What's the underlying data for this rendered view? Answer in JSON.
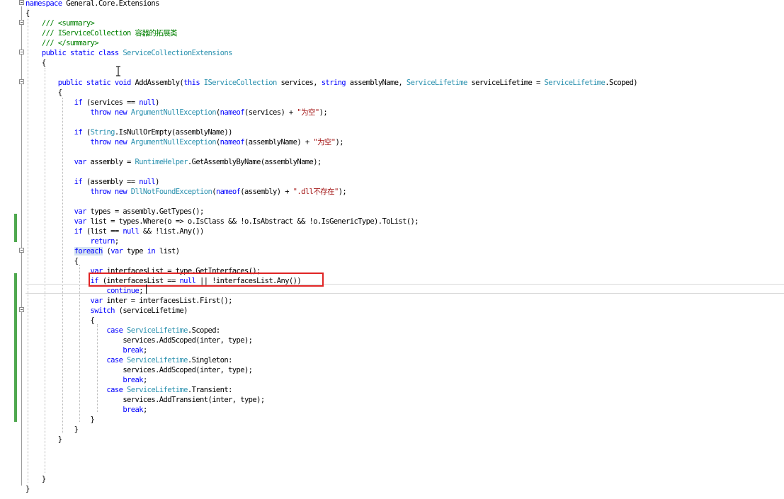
{
  "editor": {
    "lines": [
      [
        [
          "namespace",
          "kw"
        ],
        [
          " General.Core.Extensions",
          ""
        ]
      ],
      [
        [
          "{",
          ""
        ]
      ],
      [
        [
          "    /// <summary>",
          "cm"
        ]
      ],
      [
        [
          "    /// IServiceCollection 容器的拓展类",
          "cm"
        ]
      ],
      [
        [
          "    /// </summary>",
          "cm"
        ]
      ],
      [
        [
          "    public static class ",
          "kw"
        ],
        [
          "ServiceCollectionExtensions",
          "ty"
        ]
      ],
      [
        [
          "    {",
          ""
        ]
      ],
      [
        [
          "",
          ""
        ]
      ],
      [
        [
          "        public static void ",
          "kw"
        ],
        [
          "AddAssembly(",
          ""
        ],
        [
          "this ",
          "kw"
        ],
        [
          "IServiceCollection",
          "ty"
        ],
        [
          " services, ",
          ""
        ],
        [
          "string ",
          "kw"
        ],
        [
          "assemblyName, ",
          ""
        ],
        [
          "ServiceLifetime",
          "ty"
        ],
        [
          " serviceLifetime = ",
          ""
        ],
        [
          "ServiceLifetime",
          "ty"
        ],
        [
          ".Scoped)",
          ""
        ]
      ],
      [
        [
          "        {",
          ""
        ]
      ],
      [
        [
          "            if ",
          "kw"
        ],
        [
          "(services == ",
          ""
        ],
        [
          "null",
          "kw"
        ],
        [
          ")",
          ""
        ]
      ],
      [
        [
          "                throw new ",
          "kw"
        ],
        [
          "ArgumentNullException",
          "ty"
        ],
        [
          "(",
          ""
        ],
        [
          "nameof",
          "kw"
        ],
        [
          "(services) + ",
          ""
        ],
        [
          "\"为空\"",
          "st"
        ],
        [
          ");",
          ""
        ]
      ],
      [
        [
          "",
          ""
        ]
      ],
      [
        [
          "            if ",
          "kw"
        ],
        [
          "(",
          ""
        ],
        [
          "String",
          "ty"
        ],
        [
          ".IsNullOrEmpty(assemblyName))",
          ""
        ]
      ],
      [
        [
          "                throw new ",
          "kw"
        ],
        [
          "ArgumentNullException",
          "ty"
        ],
        [
          "(",
          ""
        ],
        [
          "nameof",
          "kw"
        ],
        [
          "(assemblyName) + ",
          ""
        ],
        [
          "\"为空\"",
          "st"
        ],
        [
          ");",
          ""
        ]
      ],
      [
        [
          "",
          ""
        ]
      ],
      [
        [
          "            var ",
          "kw"
        ],
        [
          "assembly = ",
          ""
        ],
        [
          "RuntimeHelper",
          "ty"
        ],
        [
          ".GetAssemblyByName(assemblyName);",
          ""
        ]
      ],
      [
        [
          "",
          ""
        ]
      ],
      [
        [
          "            if ",
          "kw"
        ],
        [
          "(assembly == ",
          ""
        ],
        [
          "null",
          "kw"
        ],
        [
          ")",
          ""
        ]
      ],
      [
        [
          "                throw new ",
          "kw"
        ],
        [
          "DllNotFoundException",
          "ty"
        ],
        [
          "(",
          ""
        ],
        [
          "nameof",
          "kw"
        ],
        [
          "(assembly) + ",
          ""
        ],
        [
          "\".dll不存在\"",
          "st"
        ],
        [
          ");",
          ""
        ]
      ],
      [
        [
          "",
          ""
        ]
      ],
      [
        [
          "            var ",
          "kw"
        ],
        [
          "types = assembly.GetTypes();",
          ""
        ]
      ],
      [
        [
          "            var ",
          "kw"
        ],
        [
          "list = types.Where(o => o.IsClass && !o.IsAbstract && !o.IsGenericType).ToList();",
          ""
        ]
      ],
      [
        [
          "            if ",
          "kw"
        ],
        [
          "(list == ",
          ""
        ],
        [
          "null ",
          "kw"
        ],
        [
          "&& !list.Any())",
          ""
        ]
      ],
      [
        [
          "                return",
          "kw"
        ],
        [
          ";",
          ""
        ]
      ],
      [
        [
          "            ",
          ""
        ],
        [
          "foreach",
          "kw hl"
        ],
        [
          " (",
          ""
        ],
        [
          "var ",
          "kw"
        ],
        [
          "type ",
          ""
        ],
        [
          "in ",
          "kw"
        ],
        [
          "list)",
          ""
        ]
      ],
      [
        [
          "            {",
          ""
        ]
      ],
      [
        [
          "                var ",
          "kw"
        ],
        [
          "interfacesList = type.GetInterfaces();",
          ""
        ]
      ],
      [
        [
          "                if ",
          "kw"
        ],
        [
          "(interfacesList == ",
          ""
        ],
        [
          "null ",
          "kw"
        ],
        [
          "|| !interfacesList.Any())",
          ""
        ]
      ],
      [
        [
          "                    continue",
          "kw"
        ],
        [
          ";",
          ""
        ]
      ],
      [
        [
          "                var ",
          "kw"
        ],
        [
          "inter = interfacesList.First();",
          ""
        ]
      ],
      [
        [
          "                switch ",
          "kw"
        ],
        [
          "(serviceLifetime)",
          ""
        ]
      ],
      [
        [
          "                {",
          ""
        ]
      ],
      [
        [
          "                    case ",
          "kw"
        ],
        [
          "ServiceLifetime",
          "ty"
        ],
        [
          ".Scoped:",
          ""
        ]
      ],
      [
        [
          "                        services.AddScoped(inter, type);",
          ""
        ]
      ],
      [
        [
          "                        break",
          "kw"
        ],
        [
          ";",
          ""
        ]
      ],
      [
        [
          "                    case ",
          "kw"
        ],
        [
          "ServiceLifetime",
          "ty"
        ],
        [
          ".Singleton:",
          ""
        ]
      ],
      [
        [
          "                        services.AddScoped(inter, type);",
          ""
        ]
      ],
      [
        [
          "                        break",
          "kw"
        ],
        [
          ";",
          ""
        ]
      ],
      [
        [
          "                    case ",
          "kw"
        ],
        [
          "ServiceLifetime",
          "ty"
        ],
        [
          ".Transient:",
          ""
        ]
      ],
      [
        [
          "                        services.AddTransient(inter, type);",
          ""
        ]
      ],
      [
        [
          "                        break",
          "kw"
        ],
        [
          ";",
          ""
        ]
      ],
      [
        [
          "                }",
          ""
        ]
      ],
      [
        [
          "            }",
          ""
        ]
      ],
      [
        [
          "        }",
          ""
        ]
      ],
      [
        [
          "",
          ""
        ]
      ],
      [
        [
          "",
          ""
        ]
      ],
      [
        [
          "",
          ""
        ]
      ],
      [
        [
          "    }",
          ""
        ]
      ],
      [
        [
          "}",
          ""
        ]
      ]
    ]
  },
  "colors": {
    "keyword": "#0000ff",
    "type": "#2b91af",
    "comment": "#008000",
    "string": "#a31515",
    "highlight_border": "#e02424",
    "change_bar": "#4fa84f"
  }
}
